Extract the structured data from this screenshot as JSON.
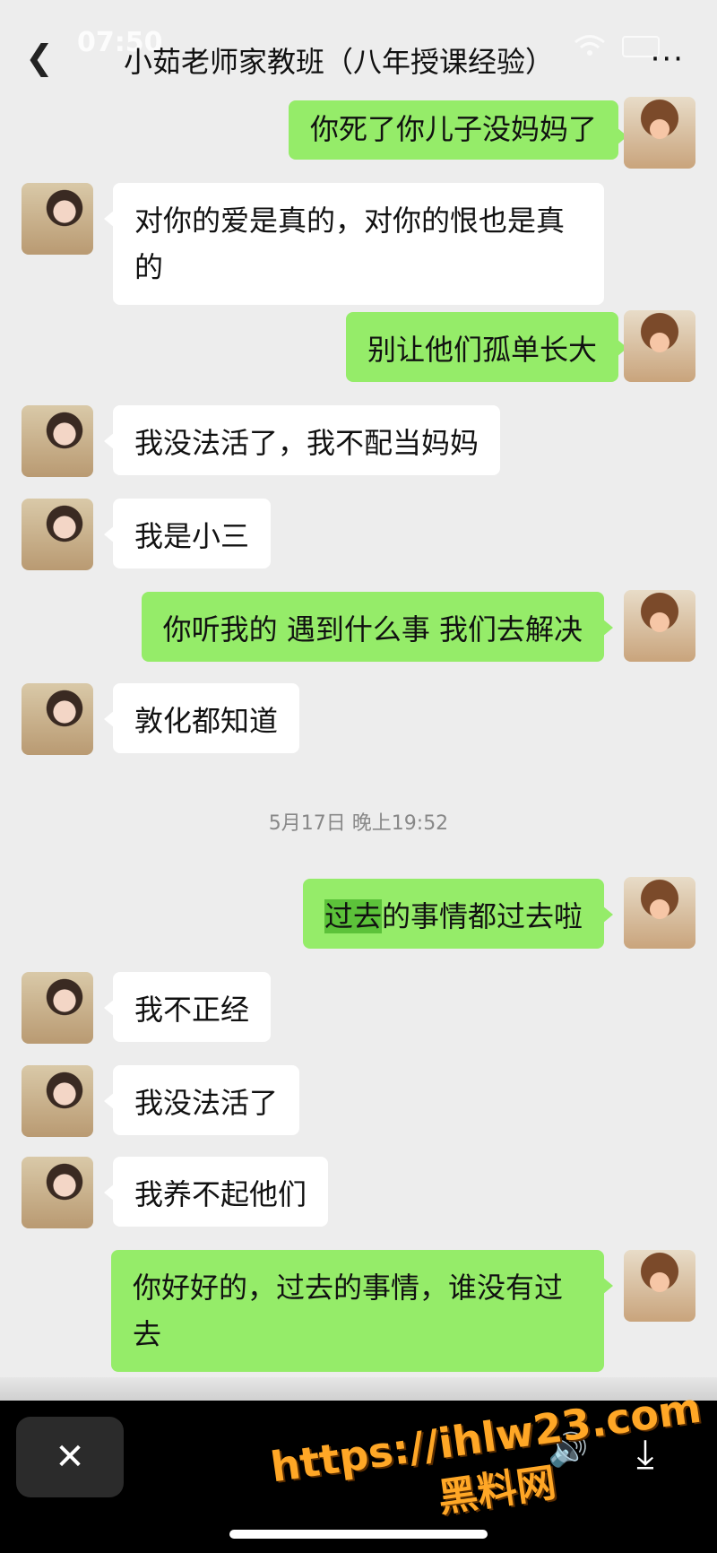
{
  "status": {
    "time": "07:50"
  },
  "header": {
    "back_icon": "chevron-left-icon",
    "title": "小茹老师家教班（八年授课经验）",
    "more_label": "···"
  },
  "messages": [
    {
      "side": "right",
      "text": "你死了你儿子没妈妈了"
    },
    {
      "side": "left",
      "text": "对你的爱是真的，对你的恨也是真的"
    },
    {
      "side": "right",
      "text": "别让他们孤单长大"
    },
    {
      "side": "left",
      "text": "我没法活了，我不配当妈妈"
    },
    {
      "side": "left",
      "text": "我是小三"
    },
    {
      "side": "right",
      "text": "你听我的 遇到什么事 我们去解决"
    },
    {
      "side": "left",
      "text": "敦化都知道"
    },
    {
      "side": "right",
      "text_highlight": "过去",
      "text_rest": "的事情都过去啦"
    },
    {
      "side": "left",
      "text": "我不正经"
    },
    {
      "side": "left",
      "text": "我没法活了"
    },
    {
      "side": "left",
      "text": "我养不起他们"
    },
    {
      "side": "right",
      "text": "你好好的，过去的事情，谁没有过去"
    }
  ],
  "timestamp": "5月17日 晚上19:52",
  "viewer": {
    "close_icon": "✕",
    "volume_icon": "🔊",
    "download_icon": "⤓",
    "watermark_url": "https://ihlw23.com",
    "watermark_name": "黑料网"
  }
}
